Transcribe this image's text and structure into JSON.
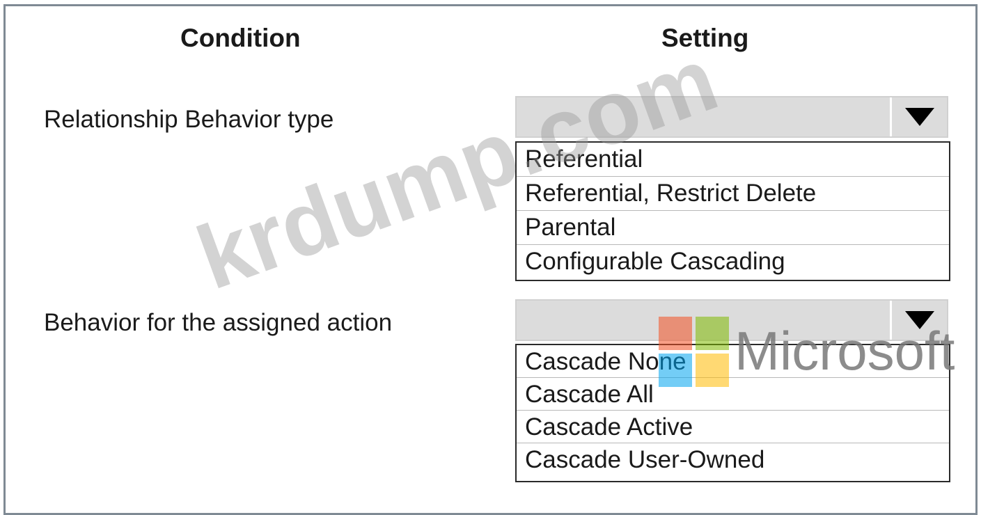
{
  "headers": {
    "condition": "Condition",
    "setting": "Setting"
  },
  "rows": [
    {
      "label": "Relationship Behavior type",
      "selected": "",
      "options": [
        "Referential",
        "Referential, Restrict Delete",
        "Parental",
        "Configurable Cascading"
      ]
    },
    {
      "label": "Behavior for the assigned action",
      "selected": "",
      "options": [
        "Cascade None",
        "Cascade All",
        "Cascade Active",
        "Cascade User-Owned"
      ]
    }
  ],
  "watermark": {
    "text": "krdump.com"
  },
  "logo": {
    "text": "Microsoft",
    "colors": [
      "#f25022",
      "#7fba00",
      "#00a4ef",
      "#ffb900"
    ]
  },
  "icons": {
    "dropdown": "triangle-down-icon"
  }
}
